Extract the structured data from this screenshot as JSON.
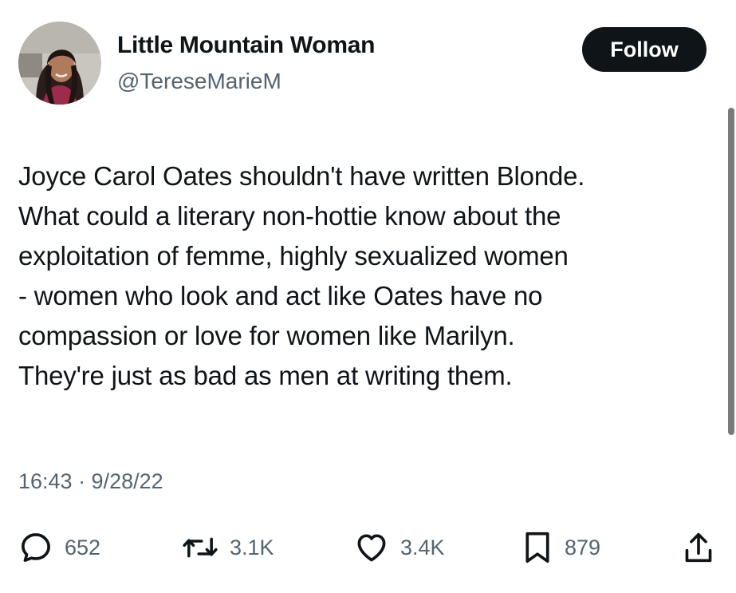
{
  "author": {
    "display_name": "Little Mountain Woman",
    "handle": "@TereseMarieM",
    "avatar_icon": "profile-photo"
  },
  "follow_label": "Follow",
  "tweet": {
    "lines": [
      "Joyce Carol Oates shouldn't have written Blonde.",
      "What could a literary non-hottie know about the",
      "exploitation of femme, highly sexualized women",
      "- women who look and act like Oates have no",
      "compassion or love for women like Marilyn.",
      "They're just as bad as men at writing them."
    ],
    "timestamp": "16:43 · 9/28/22"
  },
  "actions": {
    "replies": {
      "icon": "reply-icon",
      "count": "652"
    },
    "retweets": {
      "icon": "retweet-icon",
      "count": "3.1K"
    },
    "likes": {
      "icon": "heart-icon",
      "count": "3.4K"
    },
    "bookmarks": {
      "icon": "bookmark-icon",
      "count": "879"
    },
    "share": {
      "icon": "share-icon"
    }
  },
  "colors": {
    "text": "#0f1419",
    "secondary": "#536471",
    "follow_bg": "#0f1419"
  }
}
